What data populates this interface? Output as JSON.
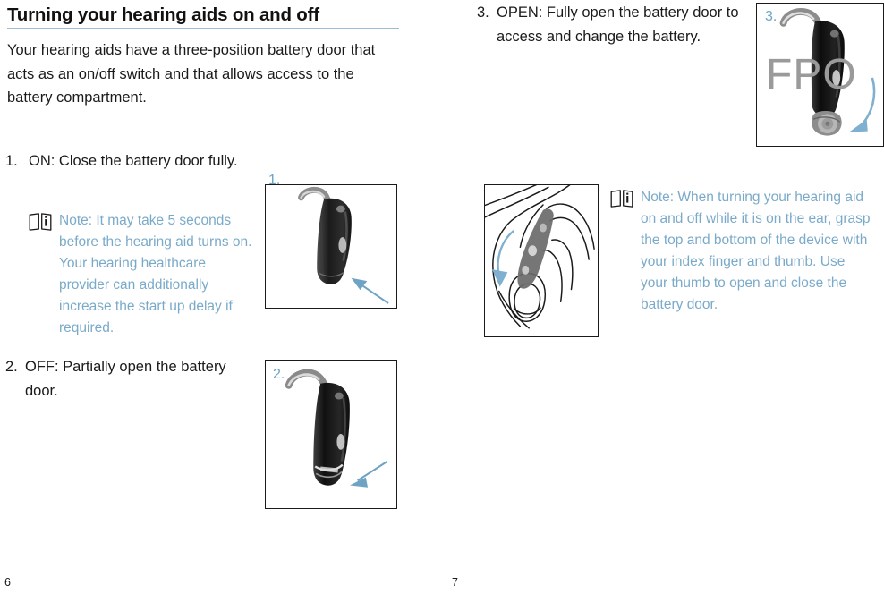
{
  "document": {
    "heading": "Turning your hearing aids on and off",
    "rule_color": "#9dbdd4",
    "accent_blue": "#7aaac9",
    "intro": "Your hearing aids have a three-position battery door that acts as an on/off switch and that allows access to the battery compartment."
  },
  "steps": [
    {
      "number": "1.",
      "text": "ON: Close the battery door fully."
    },
    {
      "number": "2.",
      "text": "OFF: Partially open the battery door."
    },
    {
      "number": "3.",
      "text": "OPEN: Fully open the battery door to access and change the battery."
    }
  ],
  "notes": [
    {
      "icon": "instructions-for-use-icon",
      "text": "Note: It may take 5 seconds before the hearing aid turns on. Your hearing healthcare provider can additionally increase the start up delay if required."
    },
    {
      "icon": "instructions-for-use-icon",
      "text": "Note: When turning your hearing aid on and off while it is on the ear, grasp the top and bottom of the device with your index finger and thumb. Use your thumb to open and close the battery door."
    }
  ],
  "figures": [
    {
      "label": "1.",
      "caption_alt": "Behind-the-ear hearing aid with battery door fully closed, blue arrow pointing to the closed door",
      "watermark": ""
    },
    {
      "label": "2.",
      "caption_alt": "Behind-the-ear hearing aid with battery door partially open, blue arrow pointing to the partially open door",
      "watermark": ""
    },
    {
      "label": "3.",
      "caption_alt": "Behind-the-ear hearing aid with battery door fully open, curved blue arrow showing the door swinging open",
      "watermark": "FPO"
    },
    {
      "label": "",
      "caption_alt": "Line drawing of a hearing aid on an ear being grasped between index finger and thumb, blue curved arrow showing the battery door opening downward",
      "watermark": ""
    }
  ],
  "page_numbers": {
    "left": "6",
    "right": "7"
  }
}
